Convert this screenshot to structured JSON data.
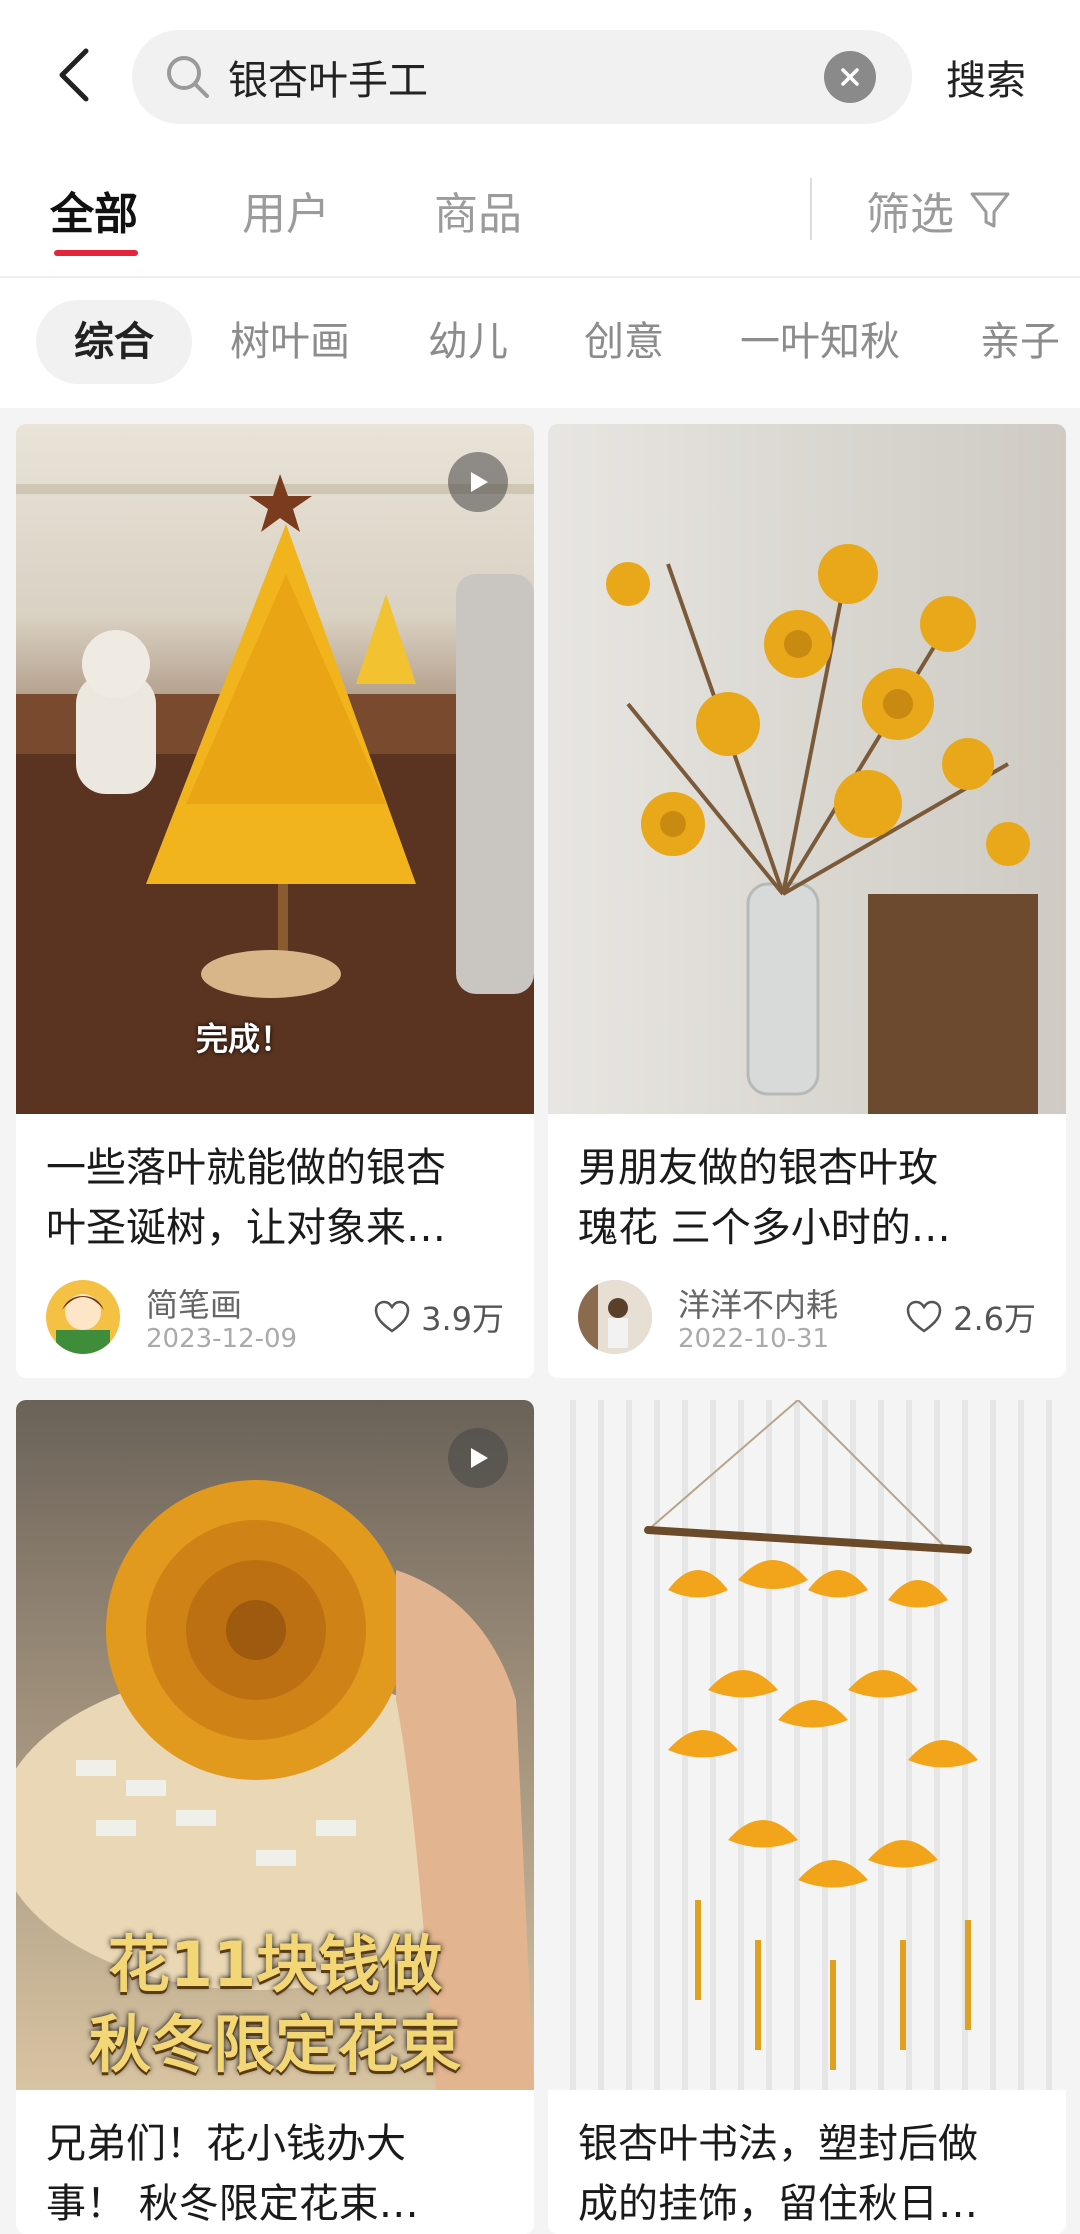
{
  "header": {
    "search_query": "银杏叶手工",
    "search_button": "搜索"
  },
  "tabs": {
    "items": [
      "全部",
      "用户",
      "商品"
    ],
    "active_index": 0,
    "filter_label": "筛选"
  },
  "chips": {
    "items": [
      "综合",
      "树叶画",
      "幼儿",
      "创意",
      "一叶知秋",
      "亲子"
    ],
    "active_index": 0
  },
  "feed": [
    {
      "title": "一些落叶就能做的银杏叶圣诞树，让对象来…",
      "title_line1": "一些落叶就能做的银杏",
      "title_line2": "叶圣诞树，让对象来…",
      "author": "简笔画",
      "date": "2023-12-09",
      "likes": "3.9万",
      "is_video": true,
      "overlay_text": "完成！"
    },
    {
      "title_line1": "男朋友做的银杏叶玫",
      "title_line2": "瑰花 三个多小时的…",
      "author": "洋洋不内耗",
      "date": "2022-10-31",
      "likes": "2.6万",
      "is_video": false
    },
    {
      "title_line1": "兄弟们！花小钱办大",
      "title_line2": "事！ 秋冬限定花束…",
      "is_video": true,
      "overlay_line1": "花11块钱做",
      "overlay_line2": "秋冬限定花束"
    },
    {
      "title_line1": "银杏叶书法，塑封后做",
      "title_line2": "成的挂饰，留住秋日…",
      "is_video": false
    }
  ],
  "colors": {
    "accent": "#e3243b",
    "ginkgo_yellow": "#f2b41c"
  }
}
